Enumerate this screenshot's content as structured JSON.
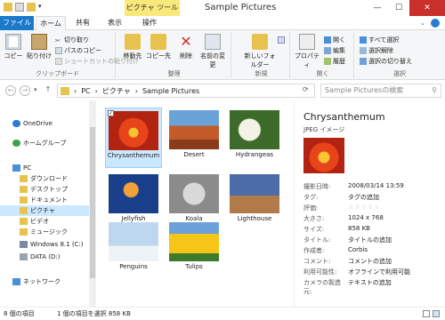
{
  "window": {
    "title": "Sample Pictures",
    "context_tab": "ピクチャ ツール",
    "controls": {
      "minimize": "—",
      "maximize": "☐",
      "close": "✕"
    }
  },
  "tabs": {
    "file": "ファイル",
    "home": "ホーム",
    "share": "共有",
    "view": "表示",
    "manage": "操作"
  },
  "ribbon": {
    "clipboard": {
      "group": "クリップボード",
      "copy": "コピー",
      "paste": "貼り付け",
      "cut": "切り取り",
      "copy_path": "パスのコピー",
      "paste_shortcut": "ショートカットの貼り付け"
    },
    "organize": {
      "group": "整理",
      "move_to": "移動先",
      "copy_to": "コピー先",
      "delete": "削除",
      "rename": "名前の変更"
    },
    "new": {
      "group": "新規",
      "new_folder": "新しいフォルダー"
    },
    "open": {
      "group": "開く",
      "properties": "プロパティ",
      "open": "開く",
      "edit": "編集",
      "history": "履歴"
    },
    "select": {
      "group": "選択",
      "select_all": "すべて選択",
      "select_none": "選択解除",
      "invert": "選択の切り替え"
    }
  },
  "address": {
    "segments": [
      "PC",
      "ピクチャ",
      "Sample Pictures"
    ],
    "search_placeholder": "Sample Picturesの検索"
  },
  "nav": {
    "items": [
      {
        "label": "OneDrive",
        "color": "#2a7bd3"
      },
      {
        "label": "ホームグループ",
        "color": "#3aa346"
      },
      {
        "label": "PC",
        "color": "#4a90d9"
      },
      {
        "label": "ダウンロード",
        "color": "#e8c24e"
      },
      {
        "label": "デスクトップ",
        "color": "#e8c24e"
      },
      {
        "label": "ドキュメント",
        "color": "#e8c24e"
      },
      {
        "label": "ピクチャ",
        "color": "#e8c24e"
      },
      {
        "label": "ビデオ",
        "color": "#e8c24e"
      },
      {
        "label": "ミュージック",
        "color": "#e8c24e"
      },
      {
        "label": "Windows 8.1 (C:)",
        "color": "#7a8ca0"
      },
      {
        "label": "DATA (D:)",
        "color": "#9aa4ad"
      },
      {
        "label": "ネットワーク",
        "color": "#4a90d9"
      }
    ]
  },
  "files": [
    {
      "name": "Chrysanthemum",
      "selected": true
    },
    {
      "name": "Desert",
      "selected": false
    },
    {
      "name": "Hydrangeas",
      "selected": false
    },
    {
      "name": "Jellyfish",
      "selected": false
    },
    {
      "name": "Koala",
      "selected": false
    },
    {
      "name": "Lighthouse",
      "selected": false
    },
    {
      "name": "Penguins",
      "selected": false
    },
    {
      "name": "Tulips",
      "selected": false
    }
  ],
  "details": {
    "title": "Chrysanthemum",
    "type": "JPEG イメージ",
    "rows": [
      {
        "k": "撮影日時:",
        "v": "2008/03/14 13:59"
      },
      {
        "k": "タグ:",
        "v": "タグの追加"
      },
      {
        "k": "評価:",
        "v": "☆☆☆☆☆"
      },
      {
        "k": "大きさ:",
        "v": "1024 x 768"
      },
      {
        "k": "サイズ:",
        "v": "858 KB"
      },
      {
        "k": "タイトル:",
        "v": "タイトルの追加"
      },
      {
        "k": "作成者:",
        "v": "Corbis"
      },
      {
        "k": "コメント:",
        "v": "コメントの追加"
      },
      {
        "k": "利用可能性:",
        "v": "オフラインで利用可能"
      },
      {
        "k": "カメラの製造元:",
        "v": "テキストの追加"
      }
    ]
  },
  "status": {
    "count": "8 個の項目",
    "selection": "1 個の項目を選択  858 KB"
  }
}
